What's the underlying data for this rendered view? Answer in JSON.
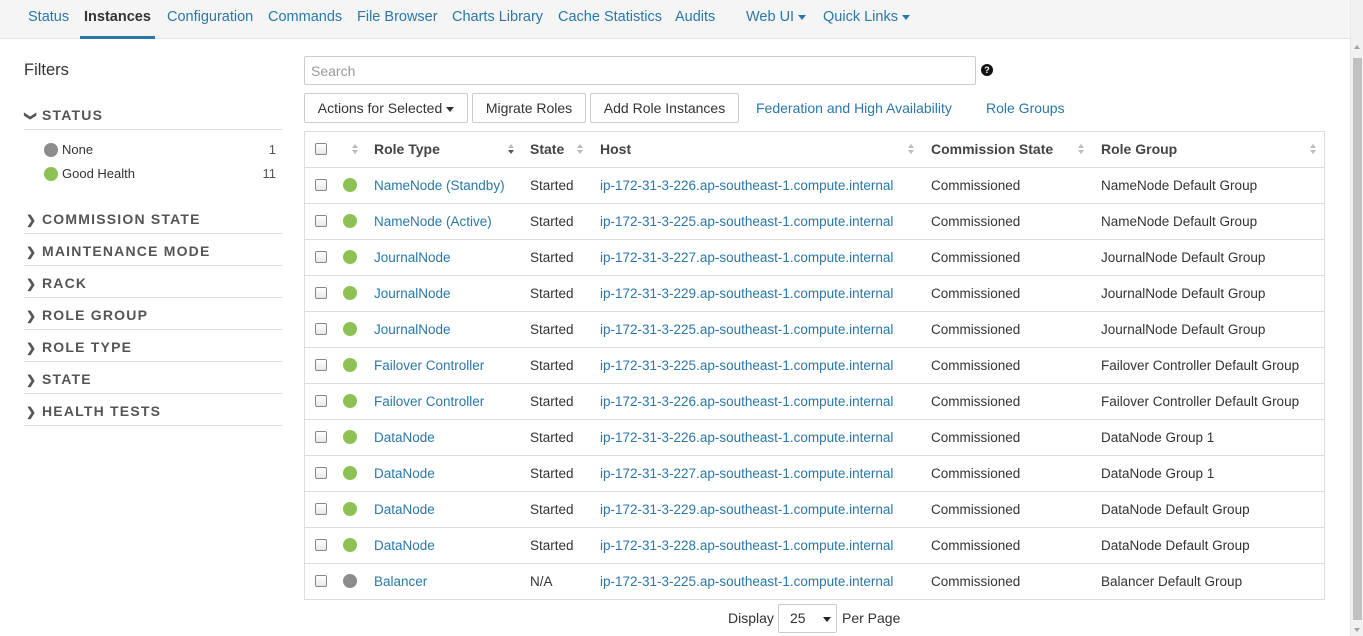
{
  "nav": {
    "tabs": [
      {
        "label": "Status"
      },
      {
        "label": "Instances"
      },
      {
        "label": "Configuration"
      },
      {
        "label": "Commands"
      },
      {
        "label": "File Browser"
      },
      {
        "label": "Charts Library"
      },
      {
        "label": "Cache Statistics"
      },
      {
        "label": "Audits"
      },
      {
        "label": "Web UI"
      },
      {
        "label": "Quick Links"
      }
    ]
  },
  "filters": {
    "title": "Filters",
    "status": {
      "title": "STATUS",
      "items": [
        {
          "label": "None",
          "count": "1",
          "color": "#8c8c8c"
        },
        {
          "label": "Good Health",
          "count": "11",
          "color": "#8dc153"
        }
      ]
    },
    "sections": [
      {
        "title": "COMMISSION STATE"
      },
      {
        "title": "MAINTENANCE MODE"
      },
      {
        "title": "RACK"
      },
      {
        "title": "ROLE GROUP"
      },
      {
        "title": "ROLE TYPE"
      },
      {
        "title": "STATE"
      },
      {
        "title": "HEALTH TESTS"
      }
    ]
  },
  "search": {
    "placeholder": "Search",
    "value": ""
  },
  "toolbar": {
    "actions_label": "Actions for Selected",
    "migrate_label": "Migrate Roles",
    "add_label": "Add Role Instances",
    "federation_label": "Federation and High Availability",
    "role_groups_label": "Role Groups"
  },
  "table": {
    "headers": {
      "role_type": "Role Type",
      "state": "State",
      "host": "Host",
      "commission_state": "Commission State",
      "role_group": "Role Group"
    },
    "colors": {
      "good": "#8dc153",
      "none": "#8c8c8c"
    },
    "rows": [
      {
        "health": "good",
        "role_type": "NameNode (Standby)",
        "state": "Started",
        "host": "ip-172-31-3-226.ap-southeast-1.compute.internal",
        "commission_state": "Commissioned",
        "role_group": "NameNode Default Group"
      },
      {
        "health": "good",
        "role_type": "NameNode (Active)",
        "state": "Started",
        "host": "ip-172-31-3-225.ap-southeast-1.compute.internal",
        "commission_state": "Commissioned",
        "role_group": "NameNode Default Group"
      },
      {
        "health": "good",
        "role_type": "JournalNode",
        "state": "Started",
        "host": "ip-172-31-3-227.ap-southeast-1.compute.internal",
        "commission_state": "Commissioned",
        "role_group": "JournalNode Default Group"
      },
      {
        "health": "good",
        "role_type": "JournalNode",
        "state": "Started",
        "host": "ip-172-31-3-229.ap-southeast-1.compute.internal",
        "commission_state": "Commissioned",
        "role_group": "JournalNode Default Group"
      },
      {
        "health": "good",
        "role_type": "JournalNode",
        "state": "Started",
        "host": "ip-172-31-3-225.ap-southeast-1.compute.internal",
        "commission_state": "Commissioned",
        "role_group": "JournalNode Default Group"
      },
      {
        "health": "good",
        "role_type": "Failover Controller",
        "state": "Started",
        "host": "ip-172-31-3-225.ap-southeast-1.compute.internal",
        "commission_state": "Commissioned",
        "role_group": "Failover Controller Default Group"
      },
      {
        "health": "good",
        "role_type": "Failover Controller",
        "state": "Started",
        "host": "ip-172-31-3-226.ap-southeast-1.compute.internal",
        "commission_state": "Commissioned",
        "role_group": "Failover Controller Default Group"
      },
      {
        "health": "good",
        "role_type": "DataNode",
        "state": "Started",
        "host": "ip-172-31-3-226.ap-southeast-1.compute.internal",
        "commission_state": "Commissioned",
        "role_group": "DataNode Group 1"
      },
      {
        "health": "good",
        "role_type": "DataNode",
        "state": "Started",
        "host": "ip-172-31-3-227.ap-southeast-1.compute.internal",
        "commission_state": "Commissioned",
        "role_group": "DataNode Group 1"
      },
      {
        "health": "good",
        "role_type": "DataNode",
        "state": "Started",
        "host": "ip-172-31-3-229.ap-southeast-1.compute.internal",
        "commission_state": "Commissioned",
        "role_group": "DataNode Default Group"
      },
      {
        "health": "good",
        "role_type": "DataNode",
        "state": "Started",
        "host": "ip-172-31-3-228.ap-southeast-1.compute.internal",
        "commission_state": "Commissioned",
        "role_group": "DataNode Default Group"
      },
      {
        "health": "none",
        "role_type": "Balancer",
        "state": "N/A",
        "host": "ip-172-31-3-225.ap-southeast-1.compute.internal",
        "commission_state": "Commissioned",
        "role_group": "Balancer Default Group"
      }
    ]
  },
  "pagination": {
    "display_label": "Display",
    "per_page_value": "25",
    "per_page_label": "Per Page"
  }
}
